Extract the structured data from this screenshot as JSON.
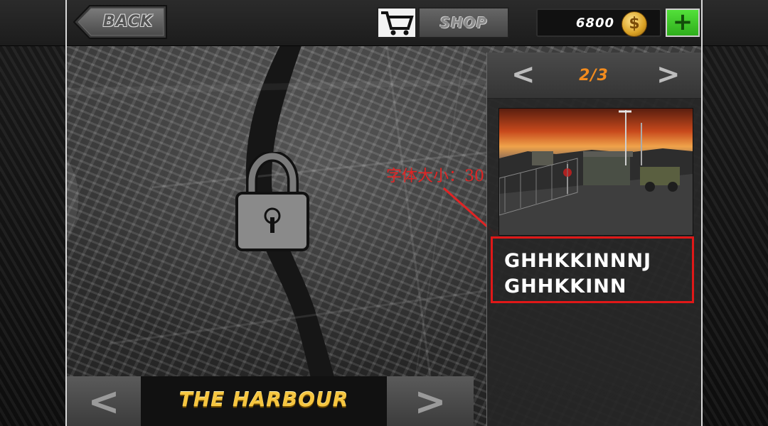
{
  "header": {
    "back_label": "BACK",
    "shop_label": "SHOP",
    "coins": "6800",
    "coin_symbol": "$",
    "add_label": "+"
  },
  "level_panel": {
    "prev_arrow": "<",
    "next_arrow": ">",
    "page_indicator": "2/3",
    "description_lines": [
      "GHHKKINNNJ",
      "GHHKKINN"
    ]
  },
  "annotation": {
    "text": "字体大小：30",
    "color": "#e02424"
  },
  "map_selector": {
    "prev_arrow": "<",
    "next_arrow": ">",
    "map_name": "THE HARBOUR",
    "locked": true
  },
  "colors": {
    "accent_orange": "#f28b1e",
    "gold_text": "#f6c640",
    "plus_green": "#2fae1c",
    "highlight_red": "#e01818"
  }
}
